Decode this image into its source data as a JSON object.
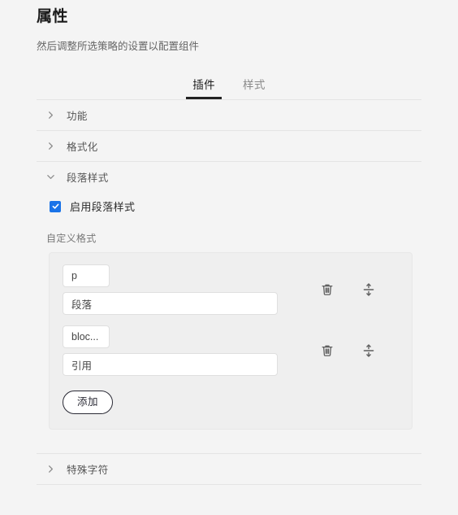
{
  "header": {
    "title": "属性",
    "subtitle": "然后调整所选策略的设置以配置组件"
  },
  "tabs": [
    {
      "label": "插件",
      "name": "tab-plugins",
      "active": true
    },
    {
      "label": "样式",
      "name": "tab-styles",
      "active": false
    }
  ],
  "accordion": [
    {
      "label": "功能",
      "icon": "chevron-right-icon",
      "expanded": false
    },
    {
      "label": "格式化",
      "icon": "chevron-right-icon",
      "expanded": false
    },
    {
      "label": "段落样式",
      "icon": "chevron-down-icon",
      "expanded": true
    },
    {
      "label": "特殊字符",
      "icon": "chevron-right-icon",
      "expanded": false
    }
  ],
  "paragraph_styles": {
    "enable_checkbox": {
      "label": "启用段落样式",
      "checked": true,
      "icon": "checkmark-icon",
      "color": "#1a73e8"
    },
    "custom_format_label": "自定义格式",
    "rows": [
      {
        "tag_value": "p",
        "tag_placeholder": "",
        "name_value": "段落",
        "name_placeholder": "",
        "delete_icon": "trash-icon",
        "reorder_icon": "move-vertical-icon"
      },
      {
        "tag_value": "bloc...",
        "tag_placeholder": "",
        "name_value": "引用",
        "name_placeholder": "",
        "delete_icon": "trash-icon",
        "reorder_icon": "move-vertical-icon"
      }
    ],
    "add_button_label": "添加"
  },
  "colors": {
    "background": "#f4f4f4",
    "card": "#efefef",
    "accent": "#1a73e8",
    "tab_active_underline": "#222222",
    "divider": "#e4e4e4",
    "text_primary": "#1a1a1a",
    "text_secondary": "#777777"
  }
}
